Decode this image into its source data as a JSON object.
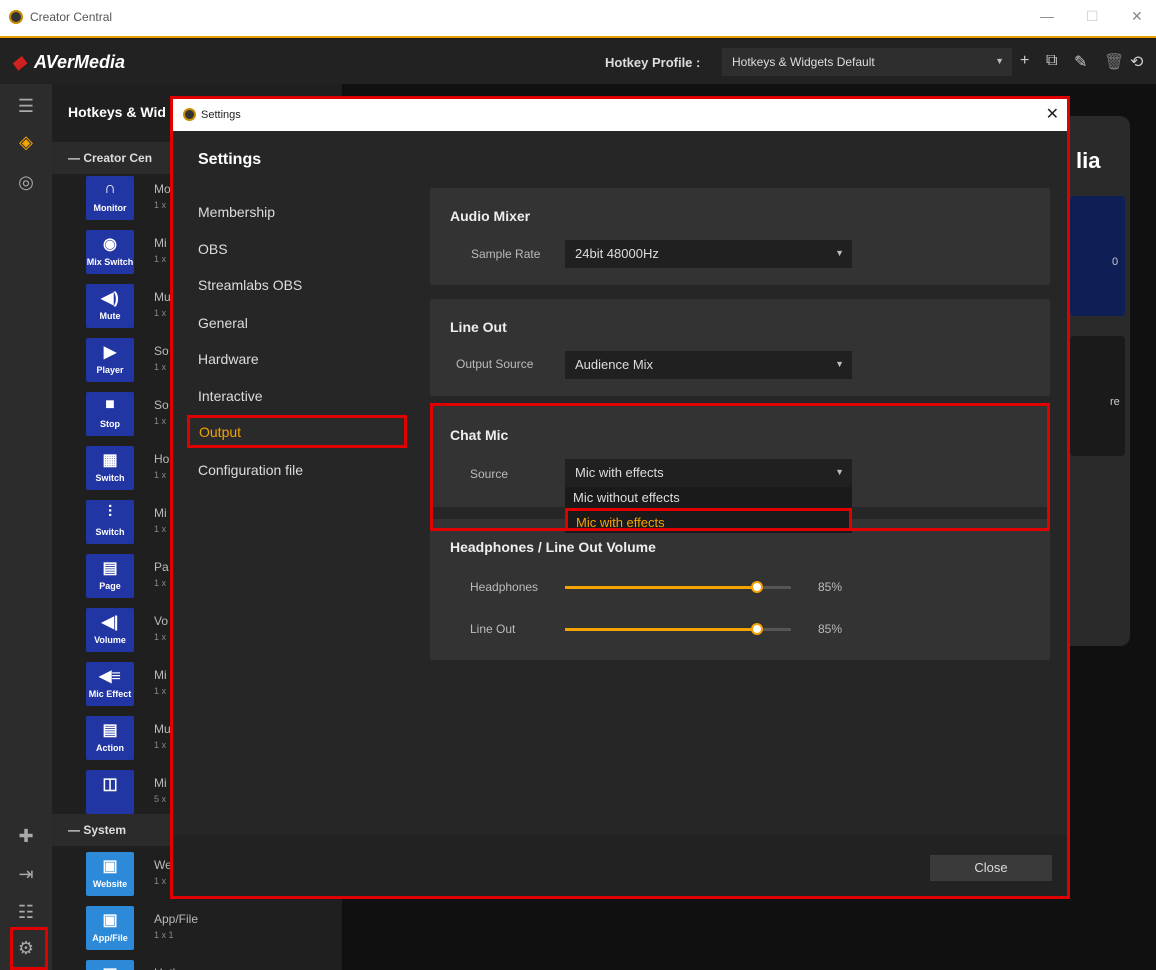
{
  "window": {
    "title": "Creator Central",
    "minimize": "—",
    "maximize": "☐",
    "close": "✕"
  },
  "header": {
    "logo": "AVerMedia",
    "hotkey_profile_label": "Hotkey Profile :",
    "hotkey_profile_value": "Hotkeys & Widgets Default"
  },
  "panel": {
    "title": "Hotkeys & Wid",
    "group_creator": "—   Creator Cen",
    "group_system": "—   System",
    "widgets": [
      {
        "tile": "Monitor",
        "name": "Mo",
        "sub": "1 x"
      },
      {
        "tile": "Mix Switch",
        "name": "Mi",
        "sub": "1 x"
      },
      {
        "tile": "Mute",
        "name": "Mu",
        "sub": "1 x"
      },
      {
        "tile": "Player",
        "name": "So",
        "sub": "1 x"
      },
      {
        "tile": "Stop",
        "name": "So",
        "sub": "1 x"
      },
      {
        "tile": "Switch",
        "name": "Ho",
        "sub": "1 x"
      },
      {
        "tile": "Switch",
        "name": "Mi",
        "sub": "1 x"
      },
      {
        "tile": "Page",
        "name": "Pa",
        "sub": "1 x"
      },
      {
        "tile": "Volume",
        "name": "Vo",
        "sub": "1 x"
      },
      {
        "tile": "Mic Effect",
        "name": "Mi",
        "sub": "1 x"
      },
      {
        "tile": "Action",
        "name": "Mu",
        "sub": "1 x"
      },
      {
        "tile": "",
        "name": "Mi",
        "sub": "5 x"
      }
    ],
    "system_widgets": [
      {
        "tile": "Website",
        "name": "We",
        "sub": "1 x"
      },
      {
        "tile": "App/File",
        "name": "App/File",
        "sub": "1 x 1"
      },
      {
        "tile": "",
        "name": "Hotkey",
        "sub": ""
      }
    ]
  },
  "right": {
    "device_text": "lia",
    "vals": [
      "0",
      "re"
    ]
  },
  "dialog": {
    "title": "Settings",
    "heading": "Settings",
    "nav": [
      "Membership",
      "OBS",
      "Streamlabs OBS",
      "General",
      "Hardware",
      "Interactive",
      "Output",
      "Configuration file"
    ],
    "audio_mixer": {
      "title": "Audio Mixer",
      "label": "Sample Rate",
      "value": "24bit 48000Hz"
    },
    "line_out": {
      "title": "Line Out",
      "label": "Output Source",
      "value": "Audience Mix"
    },
    "chat_mic": {
      "title": "Chat Mic",
      "label": "Source",
      "value": "Mic with effects",
      "options": [
        "Mic without effects",
        "Mic with effects"
      ]
    },
    "volume": {
      "title": "Headphones / Line Out Volume",
      "headphones_label": "Headphones",
      "headphones_value": "85%",
      "headphones_level": 0.85,
      "lineout_label": "Line Out",
      "lineout_value": "85%",
      "lineout_level": 0.85
    },
    "close_label": "Close"
  }
}
